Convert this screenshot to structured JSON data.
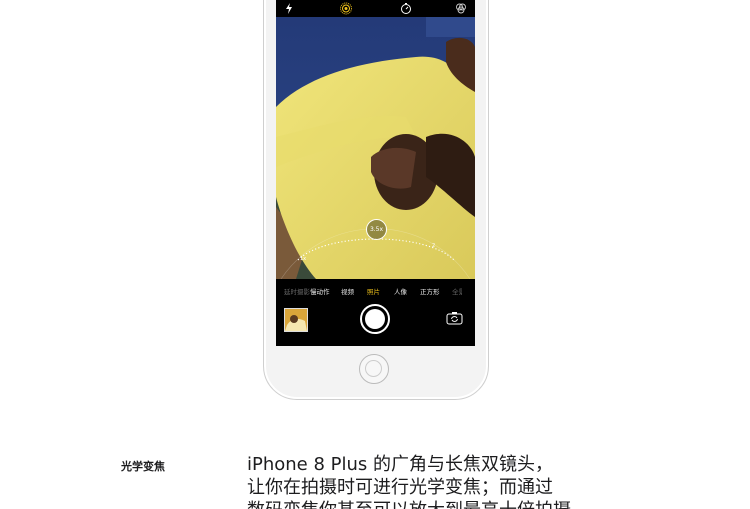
{
  "camera": {
    "top_icons": [
      "flash-icon",
      "live-photo-icon",
      "timer-icon",
      "filters-icon"
    ],
    "zoom": {
      "current": "3.5x",
      "min_label": "1x",
      "max_label": "2"
    },
    "modes": [
      {
        "label": "延时摄影",
        "state": "faded"
      },
      {
        "label": "慢动作",
        "state": "normal"
      },
      {
        "label": "视频",
        "state": "normal"
      },
      {
        "label": "照片",
        "state": "active"
      },
      {
        "label": "人像",
        "state": "normal"
      },
      {
        "label": "正方形",
        "state": "normal"
      },
      {
        "label": "全景",
        "state": "faded"
      }
    ],
    "accent_color": "#f3c51b"
  },
  "feature": {
    "label": "光学变焦",
    "lines": [
      "iPhone 8 Plus 的广角与长焦双镜头，",
      "让你在拍摄时可进行光学变焦；而通过",
      "数码变焦你甚至可以放大到最高十倍拍摄"
    ]
  }
}
